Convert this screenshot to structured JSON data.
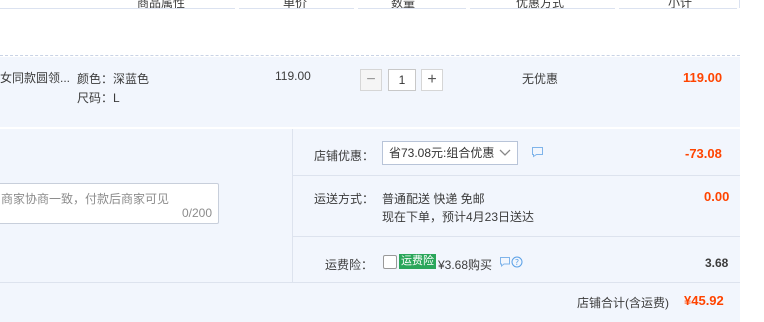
{
  "header": {
    "col_attr": "商品属性",
    "col_price": "单价",
    "col_qty": "数量",
    "col_promo": "优惠方式",
    "col_subtotal": "小计"
  },
  "item": {
    "title": "女同款圆领...",
    "attr_color": "颜色：深蓝色",
    "attr_size": "尺码：L",
    "price": "119.00",
    "quantity": "1",
    "qty_minus": "−",
    "qty_plus": "+",
    "promo": "无优惠",
    "subtotal": "119.00"
  },
  "store_discount": {
    "label": "店铺优惠：",
    "selected": "省73.08元:组合优惠",
    "amount": "-73.08"
  },
  "message": {
    "placeholder": "商家协商一致，付款后商家可见",
    "counter": "0/200"
  },
  "shipping": {
    "label": "运送方式：",
    "method": "普通配送 快递 免邮",
    "eta": "现在下单，预计4月23日送达",
    "amount": "0.00"
  },
  "insurance": {
    "label": "运费险：",
    "badge": "运费险",
    "price_text": "¥3.68购买",
    "amount": "3.68"
  },
  "total": {
    "label": "店铺合计(含运费)",
    "amount": "¥45.92"
  },
  "colors": {
    "accent_red": "#ff4400",
    "row_bg": "#f2f6fd",
    "badge_green": "#2aa65a",
    "icon_blue": "#5aa0e6"
  },
  "icons": {
    "dropdown": "chevron-down-icon",
    "message": "message-bubble-icon",
    "help": "question-circle-icon"
  }
}
